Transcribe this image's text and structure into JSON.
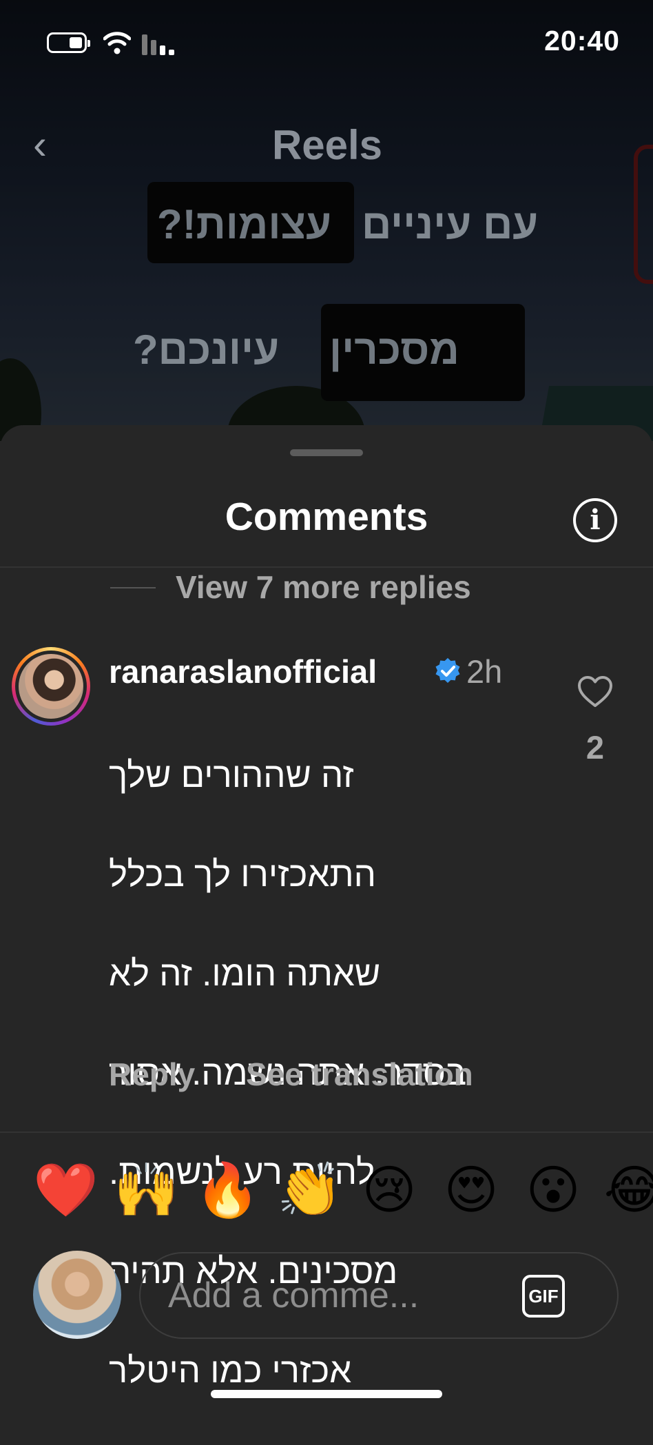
{
  "status_bar": {
    "time": "20:40",
    "icons": [
      "battery-icon",
      "wifi-icon",
      "cellular-signal-icon"
    ]
  },
  "reel": {
    "title": "Reels",
    "back_icon": "chevron-left-icon",
    "captions": [
      [
        "עם עיניים",
        "עצומות!?"
      ],
      [
        "מסכרין",
        "עיונכם?"
      ]
    ]
  },
  "comments_sheet": {
    "title": "Comments",
    "info_icon": "info-icon",
    "view_more_replies": "View 7 more replies",
    "comment": {
      "username": "ranaraslanofficial",
      "verified": true,
      "time": "2h",
      "text_lines": [
        "זה שההורים שלך",
        "התאכזירו לך בכלל",
        "שאתה הומו. זה לא",
        "בסדר. אתה נשמה. אסור",
        "להיות רע לנשמות.",
        "מסכינים. אלא תהיה",
        "אכזרי כמו היטלר"
      ],
      "like_count": "2",
      "reply_label": "Reply",
      "see_translation_label": "See translation"
    },
    "quick_reactions": [
      "❤️",
      "🙌",
      "🔥",
      "👏",
      "😢",
      "😍",
      "😮",
      "😂"
    ],
    "input": {
      "placeholder": "Add a comme...",
      "value": "",
      "gif_label": "GIF"
    }
  },
  "colors": {
    "sheet_bg": "#262626",
    "secondary_text": "#a8a8a8",
    "verified_blue": "#3797f0"
  }
}
